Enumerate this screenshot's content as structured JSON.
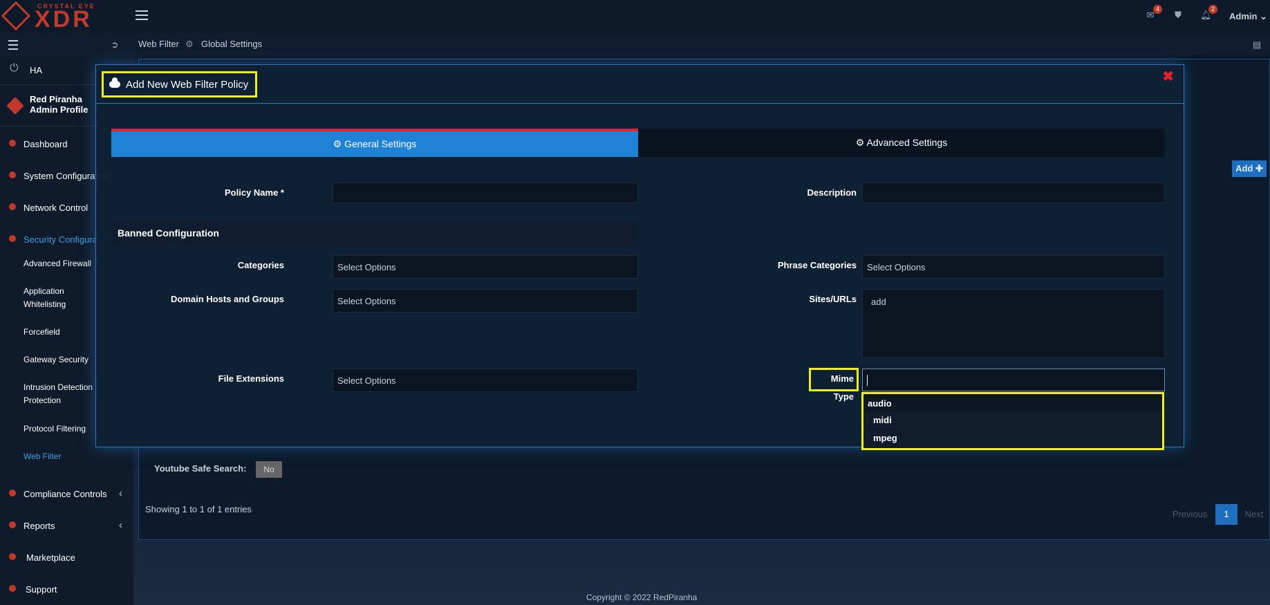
{
  "brand": {
    "line1": "CRYSTAL EYE",
    "line2": "XDR"
  },
  "topbar": {
    "mail_count": "4",
    "notif_count": "2",
    "admin_label": "Admin"
  },
  "breadcrumb": {
    "item1": "Web Filter",
    "item2": "Global Settings"
  },
  "sidebar": {
    "ha_label": "HA",
    "profile_name": "Red Piranha",
    "profile_sub": "Admin Profile",
    "items": {
      "dashboard": "Dashboard",
      "system": "System Configuration",
      "network": "Network Control",
      "security": "Security Configuration",
      "compliance": "Compliance Controls",
      "reports": "Reports",
      "marketplace": "Marketplace",
      "support": "Support"
    },
    "subitems": {
      "adv_firewall": "Advanced Firewall",
      "app_white_1": "Application",
      "app_white_2": "Whitelisting",
      "forcefield": "Forcefield",
      "gateway": "Gateway Security",
      "ids_1": "Intrusion Detection",
      "ids_2": "Protection",
      "protocol": "Protocol Filtering",
      "webfilter": "Web Filter"
    }
  },
  "background": {
    "add_button": "Add ✚",
    "youtube_label": "Youtube Safe Search:",
    "youtube_value": "No",
    "showing": "Showing 1 to 1 of 1 entries",
    "prev": "Previous",
    "page": "1",
    "next": "Next",
    "copyright": "Copyright © 2022 RedPiranha"
  },
  "modal": {
    "title": "Add New Web Filter Policy",
    "close": "✖",
    "tab_general": "General Settings",
    "tab_advanced": "Advanced Settings",
    "policy_name_label": "Policy Name *",
    "description_label": "Description",
    "banned_section": "Banned Configuration",
    "categories_label": "Categories",
    "categories_placeholder": "Select Options",
    "phrase_label": "Phrase Categories",
    "phrase_placeholder": "Select Options",
    "domain_label": "Domain Hosts and Groups",
    "domain_placeholder": "Select Options",
    "sites_label": "Sites/URLs",
    "sites_placeholder": "add",
    "file_ext_label": "File Extensions",
    "file_ext_placeholder": "Select Options",
    "mime_label": "Mime Type",
    "mime_dropdown": {
      "group": "audio",
      "options": [
        "midi",
        "mpeg"
      ]
    }
  }
}
